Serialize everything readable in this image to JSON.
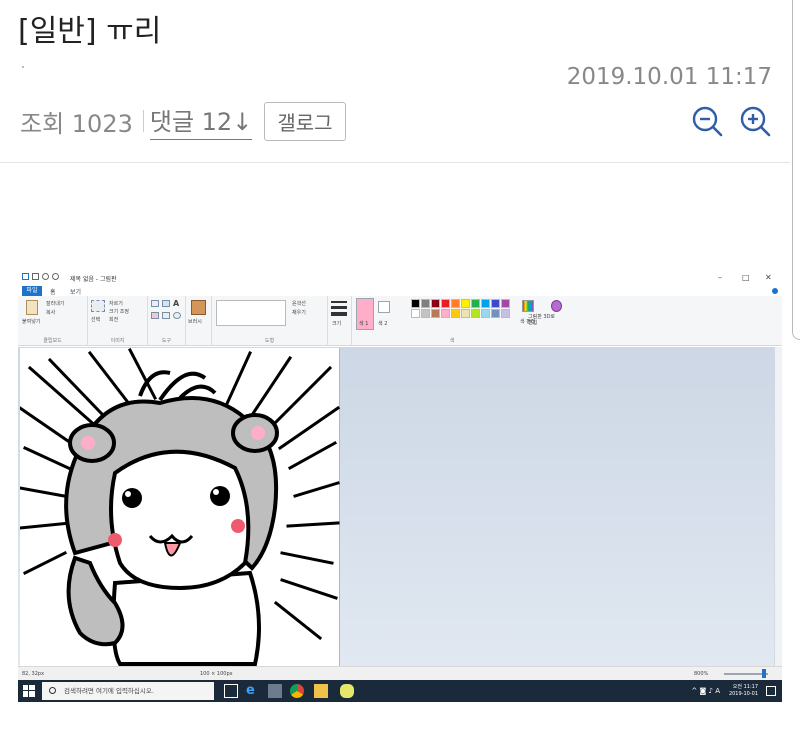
{
  "post": {
    "title": "[일반] ㅠ리",
    "timestamp": "2019.10.01 11:17",
    "views_label": "조회 1023",
    "comments_label": "댓글 12↓",
    "gallog_button": "갤로그"
  },
  "paint": {
    "window_title": "제목 없음 - 그림판",
    "tabs": [
      "파일",
      "홈",
      "보기"
    ],
    "window_controls": [
      "–",
      "□",
      "✕"
    ],
    "ribbon": {
      "clipboard": {
        "label": "클립보드",
        "paste": "붙여넣기",
        "cut": "잘라내기",
        "copy": "복사"
      },
      "image": {
        "label": "이미지",
        "select": "선택",
        "crop": "자르기",
        "resize": "크기 조정",
        "rotate": "회전"
      },
      "tools": {
        "label": "도구",
        "brush": "브러시"
      },
      "shapes": {
        "label": "도형",
        "outline": "윤곽선",
        "fill": "채우기"
      },
      "size": "크기",
      "colors": {
        "label": "색",
        "color1": "색 1",
        "color2": "색 2",
        "edit": "색 편집",
        "paint3d": "그림판 3D로 편집",
        "palette": [
          "#000000",
          "#7f7f7f",
          "#880015",
          "#ed1c24",
          "#ff7f27",
          "#fff200",
          "#22b14c",
          "#00a2e8",
          "#3f48cc",
          "#a349a4",
          "#ffffff",
          "#c3c3c3",
          "#b97a57",
          "#ffaec9",
          "#ffc90e",
          "#efe4b0",
          "#b5e61d",
          "#99d9ea",
          "#7092be",
          "#c8bfe7"
        ]
      }
    },
    "status": {
      "cursor": "82, 32px",
      "canvas_size": "100 × 100px",
      "zoom": "800%"
    },
    "taskbar": {
      "search_placeholder": "검색하려면 여기에 입력하십시오.",
      "clock_line1": "오전 11:17",
      "clock_line2": "2019-10-01",
      "ime": "A"
    },
    "colors": {
      "accent": "#1e73c8",
      "gray": "#bebebe",
      "cheek": "#f05a6e",
      "tongue": "#ff9aa5"
    }
  }
}
